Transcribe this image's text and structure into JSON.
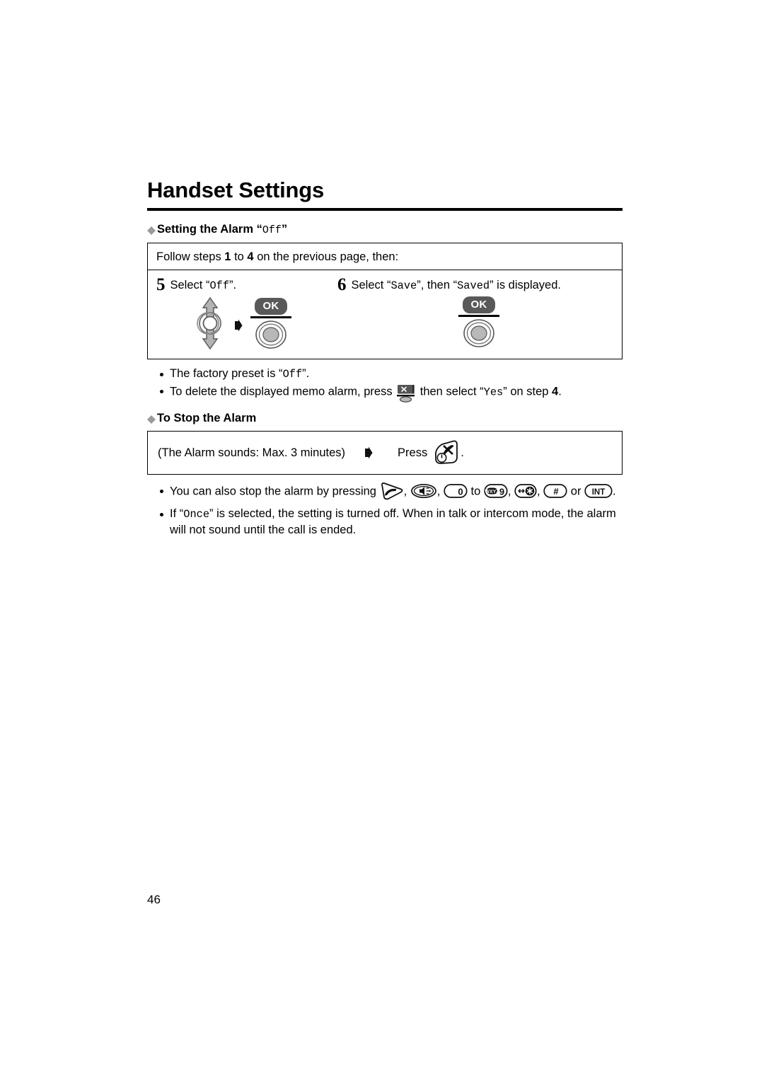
{
  "document": {
    "title": "Handset Settings",
    "page_number": "46"
  },
  "section_alarm_off": {
    "heading_text": "Setting the Alarm",
    "heading_value": "Off",
    "diamond_color": "#9a9a9a",
    "intro": {
      "prefix": "Follow steps ",
      "step_from": "1",
      "middle": " to ",
      "step_to": "4",
      "suffix": " on the previous page, then:"
    },
    "steps": [
      {
        "number": "5",
        "text_prefix": "Select “",
        "value": "Off",
        "text_suffix": "”.",
        "keys": [
          "navigator-icon",
          "ok-key-icon"
        ],
        "ok_label": "OK"
      },
      {
        "number": "6",
        "text_prefix": "Select “",
        "value": "Save",
        "text_middle": "”, then “",
        "value2": "Saved",
        "text_suffix": "” is displayed.",
        "keys": [
          "ok-key-icon"
        ],
        "ok_label": "OK"
      }
    ],
    "notes": [
      {
        "parts": [
          {
            "type": "text",
            "value": "The factory preset is “"
          },
          {
            "type": "mono",
            "value": "Off"
          },
          {
            "type": "text",
            "value": "”."
          }
        ]
      },
      {
        "parts": [
          {
            "type": "text",
            "value": "To delete the displayed memo alarm, press "
          },
          {
            "type": "icon",
            "value": "erase-key-icon"
          },
          {
            "type": "text",
            "value": " then select “"
          },
          {
            "type": "mono",
            "value": "Yes"
          },
          {
            "type": "text",
            "value": "” on step "
          },
          {
            "type": "bold",
            "value": "4"
          },
          {
            "type": "text",
            "value": "."
          }
        ]
      }
    ]
  },
  "section_stop_alarm": {
    "heading_text": "To Stop the Alarm",
    "diamond_color": "#9a9a9a",
    "box": {
      "left_text": "(The Alarm sounds: Max. 3 minutes)",
      "arrow": "right-arrow-icon",
      "press_label": "Press",
      "press_key": "power-off-key-icon",
      "period": "."
    },
    "notes": [
      {
        "parts": [
          {
            "type": "text",
            "value": "You can also stop the alarm by pressing "
          },
          {
            "type": "icon",
            "value": "talk-key-icon"
          },
          {
            "type": "text",
            "value": ", "
          },
          {
            "type": "icon",
            "value": "speakerphone-key-icon"
          },
          {
            "type": "text",
            "value": ", "
          },
          {
            "type": "icon",
            "value": "digit-0-key-icon"
          },
          {
            "type": "text",
            "value": " to "
          },
          {
            "type": "icon",
            "value": "digit-9-wxyz-key-icon"
          },
          {
            "type": "text",
            "value": ", "
          },
          {
            "type": "icon",
            "value": "star-key-icon"
          },
          {
            "type": "text",
            "value": ", "
          },
          {
            "type": "icon",
            "value": "hash-key-icon"
          },
          {
            "type": "text",
            "value": " or "
          },
          {
            "type": "icon",
            "value": "int-key-icon"
          },
          {
            "type": "text",
            "value": "."
          }
        ],
        "key_labels": {
          "digit_0": "0",
          "digit_9": "9",
          "digit_9_letters": "WXYZ",
          "star": "✳",
          "hash": "#",
          "int": "INT"
        }
      },
      {
        "parts": [
          {
            "type": "text",
            "value": "If “"
          },
          {
            "type": "mono",
            "value": "Once"
          },
          {
            "type": "text",
            "value": "” is selected, the setting is turned off. When in talk or intercom mode, the alarm will not sound until the call is ended."
          }
        ]
      }
    ]
  }
}
